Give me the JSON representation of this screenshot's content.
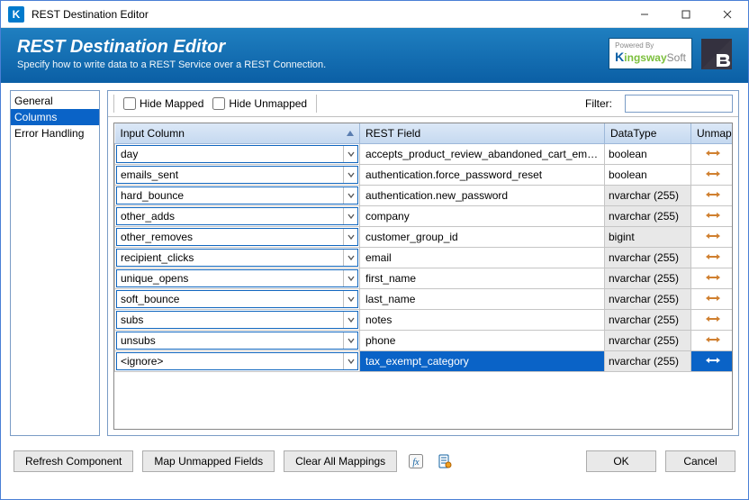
{
  "window": {
    "title": "REST Destination Editor"
  },
  "banner": {
    "heading": "REST Destination Editor",
    "subtitle": "Specify how to write data to a REST Service over a REST Connection.",
    "poweredby": "Powered By"
  },
  "sidebar": {
    "items": [
      {
        "label": "General",
        "selected": false
      },
      {
        "label": "Columns",
        "selected": true
      },
      {
        "label": "Error Handling",
        "selected": false
      }
    ]
  },
  "toolbar": {
    "hide_mapped": "Hide Mapped",
    "hide_unmapped": "Hide Unmapped",
    "filter_label": "Filter:"
  },
  "grid": {
    "columns": {
      "input": "Input Column",
      "rest": "REST Field",
      "type": "DataType",
      "unmap": "Unmap"
    },
    "rows": [
      {
        "input": "day",
        "rest": "accepts_product_review_abandoned_cart_emails",
        "type": "boolean",
        "type_readonly": false,
        "selected": false
      },
      {
        "input": "emails_sent",
        "rest": "authentication.force_password_reset",
        "type": "boolean",
        "type_readonly": false,
        "selected": false
      },
      {
        "input": "hard_bounce",
        "rest": "authentication.new_password",
        "type": "nvarchar (255)",
        "type_readonly": true,
        "selected": false
      },
      {
        "input": "other_adds",
        "rest": "company",
        "type": "nvarchar (255)",
        "type_readonly": true,
        "selected": false
      },
      {
        "input": "other_removes",
        "rest": "customer_group_id",
        "type": "bigint",
        "type_readonly": true,
        "selected": false
      },
      {
        "input": "recipient_clicks",
        "rest": "email",
        "type": "nvarchar (255)",
        "type_readonly": true,
        "selected": false
      },
      {
        "input": "unique_opens",
        "rest": "first_name",
        "type": "nvarchar (255)",
        "type_readonly": true,
        "selected": false
      },
      {
        "input": "soft_bounce",
        "rest": "last_name",
        "type": "nvarchar (255)",
        "type_readonly": true,
        "selected": false
      },
      {
        "input": "subs",
        "rest": "notes",
        "type": "nvarchar (255)",
        "type_readonly": true,
        "selected": false
      },
      {
        "input": "unsubs",
        "rest": "phone",
        "type": "nvarchar (255)",
        "type_readonly": true,
        "selected": false
      },
      {
        "input": "<ignore>",
        "rest": "tax_exempt_category",
        "type": "nvarchar (255)",
        "type_readonly": true,
        "selected": true
      }
    ]
  },
  "footer": {
    "refresh": "Refresh Component",
    "map_unmapped": "Map Unmapped Fields",
    "clear_all": "Clear All Mappings",
    "ok": "OK",
    "cancel": "Cancel"
  }
}
